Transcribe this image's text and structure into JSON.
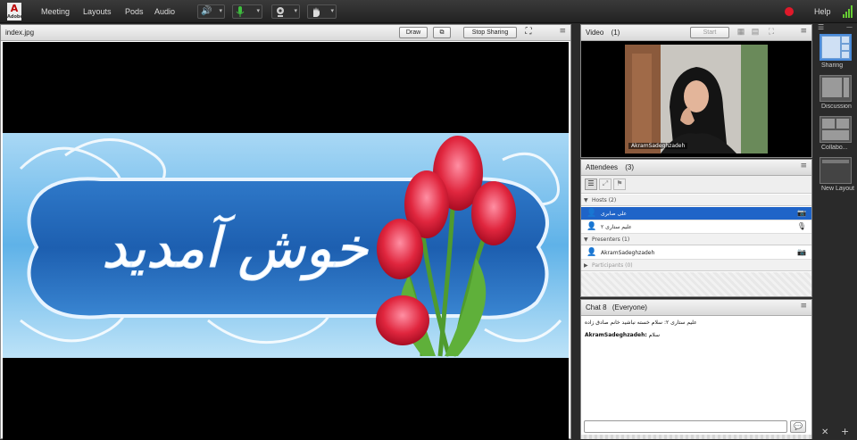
{
  "topbar": {
    "logo_text": "A",
    "logo_sub": "Adobe",
    "menu": [
      "Meeting",
      "Layouts",
      "Pods",
      "Audio"
    ],
    "help": "Help"
  },
  "share_pod": {
    "title": "index.jpg",
    "draw": "Draw",
    "stop_sharing": "Stop Sharing",
    "banner_text": "خوش آمدید"
  },
  "video_pod": {
    "title": "Video",
    "count": "(1)",
    "start_label": "Start",
    "participant_name": "AkramSadeghzadeh"
  },
  "attendees_pod": {
    "title": "Attendees",
    "count": "(3)",
    "sections": {
      "hosts": "Hosts (2)",
      "presenters": "Presenters (1)",
      "participants": "Participants (0)"
    },
    "hosts": [
      "علی صابری",
      "علیم ستاری ۲"
    ],
    "presenters": [
      "AkramSadeghzadeh"
    ]
  },
  "chat_pod": {
    "title": "Chat 8",
    "scope": "(Everyone)",
    "messages": [
      {
        "text": "علیم ستاری ۲: سلام خسته نباشید خانم صادق زاده"
      },
      {
        "sender": "AkramSadeghzadeh:",
        "text": "سلام"
      }
    ]
  },
  "layouts": [
    {
      "label": "Sharing",
      "selected": true
    },
    {
      "label": "Discussion",
      "selected": false
    },
    {
      "label": "Collabo...",
      "selected": false
    },
    {
      "label": "New Layout",
      "selected": false
    }
  ],
  "colors": {
    "accent": "#3a7bd5",
    "selected_row": "#1f64c8",
    "record_dot": "#e0192a",
    "mic_green": "#3fbf3f"
  }
}
